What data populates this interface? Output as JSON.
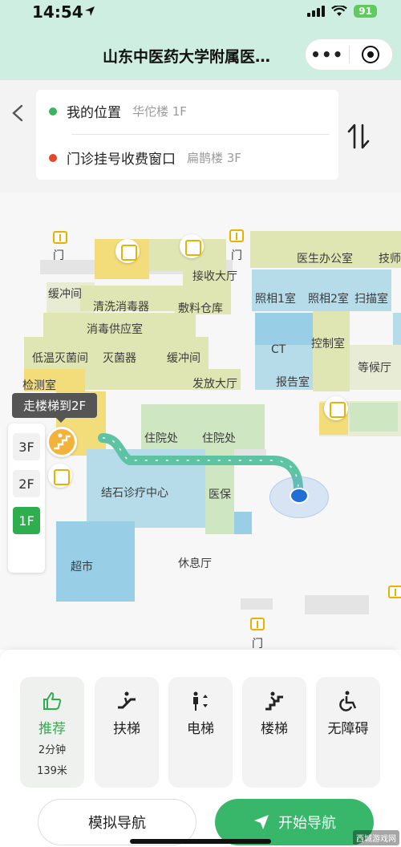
{
  "status_bar": {
    "time": "14:54",
    "battery": "91"
  },
  "title_bar": {
    "title": "山东中医药大学附属医…",
    "more_icon": "more-dots-icon",
    "close_icon": "target-circle-icon"
  },
  "route": {
    "origin": {
      "name": "我的位置",
      "building": "华佗楼 1F"
    },
    "destination": {
      "name": "门诊挂号收费窗口",
      "building": "扁鹊楼 3F"
    },
    "colors": {
      "origin": "#3bb45e",
      "destination": "#e2462b"
    }
  },
  "map": {
    "labels": {
      "door_top_left": "门",
      "door_top_mid": "门",
      "door_bottom": "门",
      "doctor_office": "医生办公室",
      "tech": "技师",
      "reception": "接收大厅",
      "buffer1": "缓冲间",
      "disinfect_room": "清洗消毒器",
      "warehouse": "敷料仓库",
      "supply": "消毒供应室",
      "low_temp": "低温灭菌间",
      "sterilizer": "灭菌器",
      "buffer2": "缓冲间",
      "test_room": "检测室",
      "dispatch": "发放大厅",
      "photo1": "照相1室",
      "photo2": "照相2室",
      "scan": "扫描室",
      "ct": "CT",
      "control": "控制室",
      "report": "报告室",
      "waiting": "等候厅",
      "inpatient1": "住院处",
      "inpatient2": "住院处",
      "lithotripsy": "结石诊疗中心",
      "insurance": "医保",
      "supermarket": "超市",
      "lounge": "休息厅"
    },
    "floor_tip": "走楼梯到2F",
    "floors": [
      "3F",
      "2F",
      "1F"
    ],
    "active_floor": "1F"
  },
  "modes": [
    {
      "label": "推荐",
      "icon": "thumbs-up-icon",
      "time": "2分钟",
      "distance": "139米"
    },
    {
      "label": "扶梯",
      "icon": "escalator-icon"
    },
    {
      "label": "电梯",
      "icon": "elevator-icon"
    },
    {
      "label": "楼梯",
      "icon": "stairs-icon"
    },
    {
      "label": "无障碍",
      "icon": "wheelchair-icon"
    }
  ],
  "actions": {
    "simulate": "模拟导航",
    "start": "开始导航"
  },
  "watermark": "西城游戏网",
  "accent_color": "#38b66a"
}
